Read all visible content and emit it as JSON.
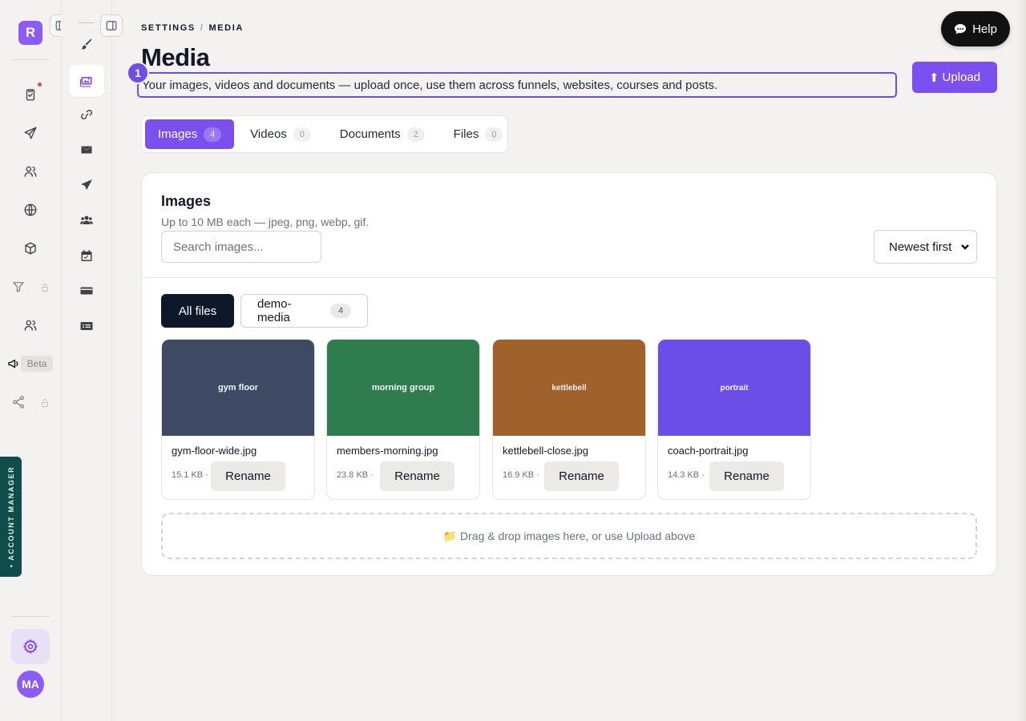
{
  "rail": {
    "logo_letter": "R",
    "beta": "Beta",
    "account_manager": "• ACCOUNT MANAGER",
    "avatar_initials": "MA"
  },
  "breadcrumb": {
    "parent": "SETTINGS",
    "separator": "/",
    "current": "MEDIA"
  },
  "page": {
    "title": "Media",
    "description": "Your images, videos and documents — upload once, use them across funnels, websites, courses and posts.",
    "step_badge": "1"
  },
  "upload_button": {
    "icon": "⬆",
    "label": "Upload"
  },
  "help_button": {
    "label": "Help"
  },
  "tabs": [
    {
      "label": "Images",
      "count": "4"
    },
    {
      "label": "Videos",
      "count": "0"
    },
    {
      "label": "Documents",
      "count": "2"
    },
    {
      "label": "Files",
      "count": "0"
    }
  ],
  "card": {
    "title": "Images",
    "subtitle": "Up to 10 MB each — jpeg, png, webp, gif.",
    "search_placeholder": "Search images...",
    "sort_selected": "Newest first"
  },
  "folders": [
    {
      "label": "All files",
      "count": ""
    },
    {
      "label": "demo-media",
      "count": "4"
    }
  ],
  "images": [
    {
      "thumb_label": "gym floor",
      "filename": "gym-floor-wide.jpg",
      "size": "15.1 KB ·",
      "rename": "Rename",
      "color": "#3e4a63"
    },
    {
      "thumb_label": "morning group",
      "filename": "members-morning.jpg",
      "size": "23.8 KB ·",
      "rename": "Rename",
      "color": "#2f7d4f"
    },
    {
      "thumb_label": "kettlebell",
      "filename": "kettlebell-close.jpg",
      "size": "16.9 KB ·",
      "rename": "Rename",
      "color": "#a0612d"
    },
    {
      "thumb_label": "portrait",
      "filename": "coach-portrait.jpg",
      "size": "14.3 KB ·",
      "rename": "Rename",
      "color": "#6b4de8"
    }
  ],
  "dropzone": {
    "icon": "📁",
    "text": "Drag & drop images here, or use Upload above"
  },
  "colors": {
    "accent": "#7c4ff0",
    "focus_outline": "#6d4ee8",
    "rail_logo": "#8b5cf6",
    "account_tab": "#0f4c4a"
  }
}
